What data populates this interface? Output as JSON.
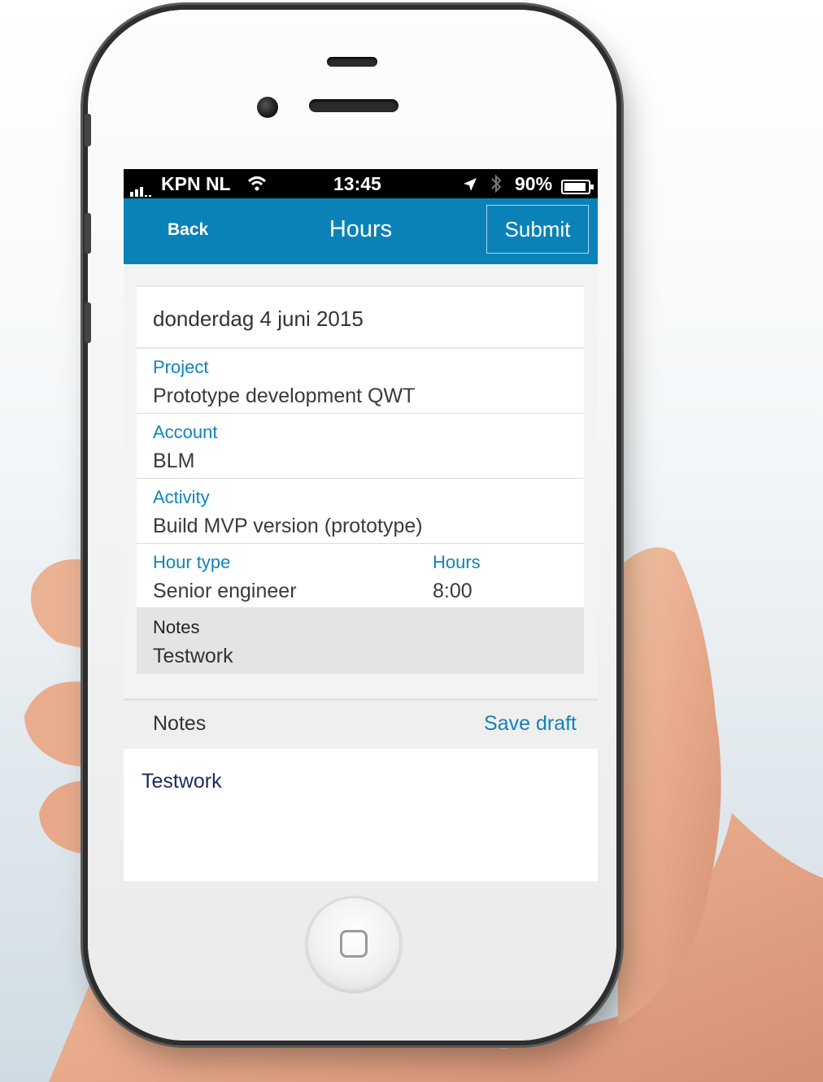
{
  "statusbar": {
    "carrier": "KPN NL",
    "time": "13:45",
    "battery": "90%"
  },
  "navbar": {
    "back_label": "Back",
    "title": "Hours",
    "submit_label": "Submit"
  },
  "form": {
    "date": "donderdag 4 juni 2015",
    "project_label": "Project",
    "project_value": "Prototype development QWT",
    "account_label": "Account",
    "account_value": "BLM",
    "activity_label": "Activity",
    "activity_value": "Build MVP version (prototype)",
    "hourtype_label": "Hour type",
    "hourtype_value": "Senior engineer",
    "hours_label": "Hours",
    "hours_value": "8:00",
    "notes_label": "Notes",
    "notes_value": "Testwork"
  },
  "notes_editor": {
    "header_label": "Notes",
    "save_draft_label": "Save draft",
    "text": "Testwork"
  },
  "colors": {
    "accent": "#0b82b7",
    "label": "#1283b8"
  }
}
